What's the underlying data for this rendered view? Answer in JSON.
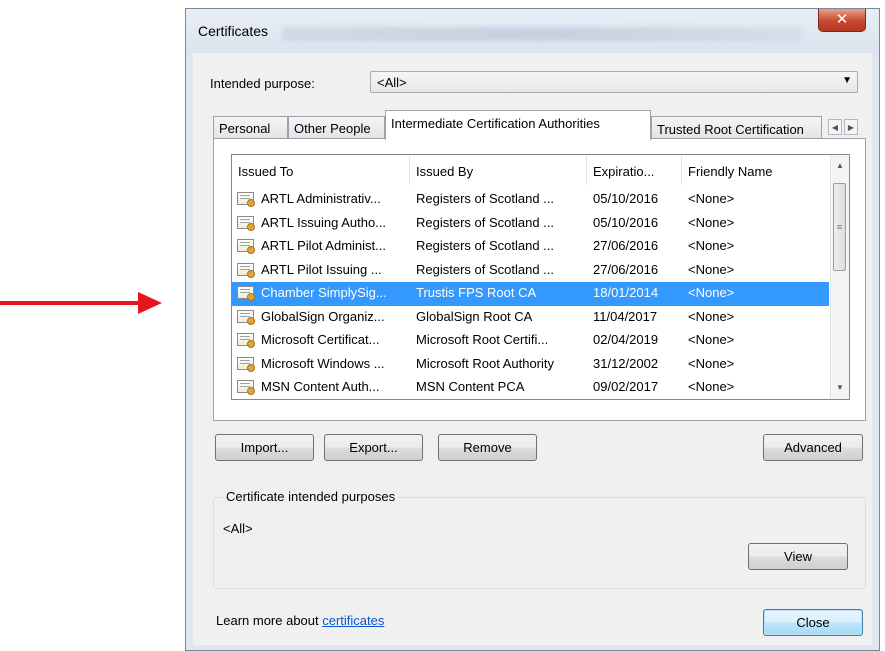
{
  "dialog": {
    "title": "Certificates",
    "close_icon": "close-x-icon"
  },
  "purpose": {
    "label": "Intended purpose:",
    "value": "<All>"
  },
  "tabs": [
    {
      "label": "Personal",
      "active": false
    },
    {
      "label": "Other People",
      "active": false
    },
    {
      "label": "Intermediate Certification Authorities",
      "active": true
    },
    {
      "label": "Trusted Root Certification",
      "active": false
    }
  ],
  "list": {
    "columns": [
      "Issued To",
      "Issued By",
      "Expiratio...",
      "Friendly Name"
    ],
    "rows": [
      {
        "issued_to": "ARTL Administrativ...",
        "issued_by": "Registers of Scotland ...",
        "expiration": "05/10/2016",
        "friendly": "<None>",
        "selected": false
      },
      {
        "issued_to": "ARTL Issuing Autho...",
        "issued_by": "Registers of Scotland ...",
        "expiration": "05/10/2016",
        "friendly": "<None>",
        "selected": false
      },
      {
        "issued_to": "ARTL Pilot Administ...",
        "issued_by": "Registers of Scotland ...",
        "expiration": "27/06/2016",
        "friendly": "<None>",
        "selected": false
      },
      {
        "issued_to": "ARTL Pilot Issuing ...",
        "issued_by": "Registers of Scotland ...",
        "expiration": "27/06/2016",
        "friendly": "<None>",
        "selected": false
      },
      {
        "issued_to": "Chamber SimplySig...",
        "issued_by": "Trustis FPS Root CA",
        "expiration": "18/01/2014",
        "friendly": "<None>",
        "selected": true
      },
      {
        "issued_to": "GlobalSign Organiz...",
        "issued_by": "GlobalSign Root CA",
        "expiration": "11/04/2017",
        "friendly": "<None>",
        "selected": false
      },
      {
        "issued_to": "Microsoft Certificat...",
        "issued_by": "Microsoft Root Certifi...",
        "expiration": "02/04/2019",
        "friendly": "<None>",
        "selected": false
      },
      {
        "issued_to": "Microsoft Windows ...",
        "issued_by": "Microsoft Root Authority",
        "expiration": "31/12/2002",
        "friendly": "<None>",
        "selected": false
      },
      {
        "issued_to": "MSN Content Auth...",
        "issued_by": "MSN Content PCA",
        "expiration": "09/02/2017",
        "friendly": "<None>",
        "selected": false
      }
    ]
  },
  "buttons": {
    "import": "Import...",
    "export": "Export...",
    "remove": "Remove",
    "advanced": "Advanced",
    "view": "View",
    "close": "Close"
  },
  "purposes_group": {
    "title": "Certificate intended purposes",
    "value": "<All>"
  },
  "learn_more": {
    "prefix": "Learn more about ",
    "link": "certificates"
  },
  "colors": {
    "arrow": "#e8141b",
    "selection": "#3399ff",
    "link": "#0b57d0"
  }
}
